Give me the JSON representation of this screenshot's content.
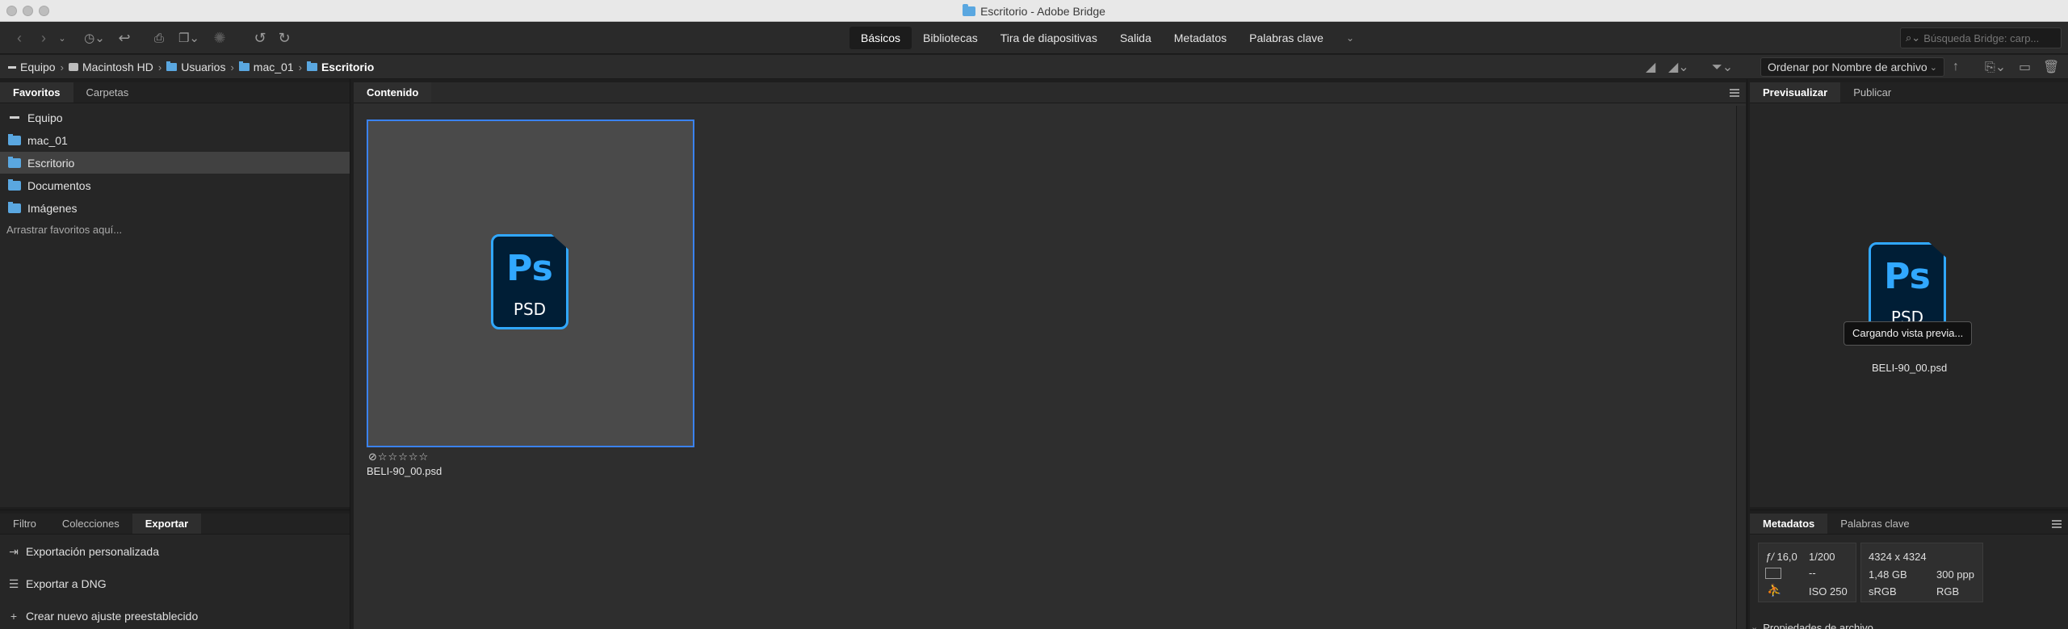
{
  "window": {
    "title": "Escritorio - Adobe Bridge"
  },
  "toolbar": {
    "workspaces": [
      {
        "label": "Básicos",
        "active": true
      },
      {
        "label": "Bibliotecas",
        "active": false
      },
      {
        "label": "Tira de diapositivas",
        "active": false
      },
      {
        "label": "Salida",
        "active": false
      },
      {
        "label": "Metadatos",
        "active": false
      },
      {
        "label": "Palabras clave",
        "active": false
      }
    ],
    "search": {
      "placeholder": "Búsqueda Bridge: carp..."
    }
  },
  "pathbar": {
    "crumbs": [
      {
        "label": "Equipo",
        "icon": "computer-icon"
      },
      {
        "label": "Macintosh HD",
        "icon": "disk-icon"
      },
      {
        "label": "Usuarios",
        "icon": "folder-icon"
      },
      {
        "label": "mac_01",
        "icon": "folder-icon"
      },
      {
        "label": "Escritorio",
        "icon": "folder-icon"
      }
    ],
    "sort_label": "Ordenar por Nombre de archivo"
  },
  "left_panel": {
    "tabs": [
      {
        "label": "Favoritos",
        "active": true
      },
      {
        "label": "Carpetas",
        "active": false
      }
    ],
    "favorites": [
      {
        "label": "Equipo",
        "icon": "computer-icon",
        "selected": false
      },
      {
        "label": "mac_01",
        "icon": "folder-icon",
        "selected": false
      },
      {
        "label": "Escritorio",
        "icon": "folder-icon",
        "selected": true
      },
      {
        "label": "Documentos",
        "icon": "folder-icon",
        "selected": false
      },
      {
        "label": "Imágenes",
        "icon": "folder-icon",
        "selected": false
      }
    ],
    "drop_hint": "Arrastrar favoritos aquí..."
  },
  "bottom_left_panel": {
    "tabs": [
      {
        "label": "Filtro",
        "active": false
      },
      {
        "label": "Colecciones",
        "active": false
      },
      {
        "label": "Exportar",
        "active": true
      }
    ],
    "export_items": [
      {
        "label": "Exportación personalizada",
        "icon": "export-icon"
      },
      {
        "label": "Exportar a DNG",
        "icon": "list-icon"
      },
      {
        "label": "Crear nuevo ajuste preestablecido",
        "icon": "plus-icon"
      }
    ]
  },
  "content": {
    "tab_label": "Contenido",
    "items": [
      {
        "filename": "BELI-90_00.psd",
        "type_top": "Ps",
        "type_bottom": "PSD",
        "rating": 0,
        "stars": "☆☆☆☆☆"
      }
    ]
  },
  "right_panel": {
    "tabs": [
      {
        "label": "Previsualizar",
        "active": true
      },
      {
        "label": "Publicar",
        "active": false
      }
    ],
    "tooltip": "Cargando vista previa...",
    "preview_filename": "BELI-90_00.psd",
    "icon_top": "Ps",
    "icon_bottom": "PSD"
  },
  "metadata_panel": {
    "tabs": [
      {
        "label": "Metadatos",
        "active": true
      },
      {
        "label": "Palabras clave",
        "active": false
      }
    ],
    "aperture": "16,0",
    "aperture_symbol": "ƒ/",
    "shutter": "1/200",
    "exposure_comp": "--",
    "iso": "ISO 250",
    "dimensions": "4324 x 4324",
    "file_size": "1,48 GB",
    "resolution": "300 ppp",
    "color_profile": "sRGB",
    "color_mode": "RGB",
    "section_label": "Propiedades de archivo"
  },
  "colors": {
    "accent": "#3a82f0",
    "folder": "#5aa7e0",
    "ps_blue": "#31a8ff",
    "ps_bg": "#001e36"
  }
}
